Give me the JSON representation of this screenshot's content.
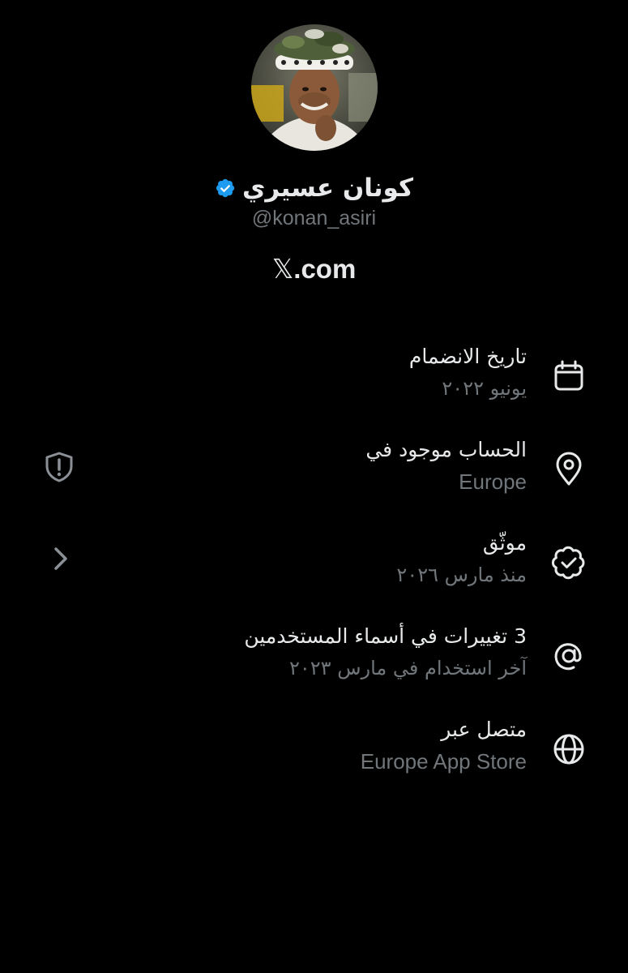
{
  "profile": {
    "display_name": "كونان عسيري",
    "handle": "@konan_asiri",
    "verified": true,
    "verified_color": "#1d9bf0",
    "avatar": "profile-photo",
    "site_mark": "𝕏",
    "site_suffix": ".com"
  },
  "rows": [
    {
      "icon": "calendar-icon",
      "title": "تاريخ الانضمام",
      "subtitle": "يونيو ٢٠٢٢"
    },
    {
      "icon": "location-pin-icon",
      "title": "الحساب موجود في",
      "subtitle": "Europe"
    },
    {
      "icon": "verified-badge-outline-icon",
      "title": "موثّق",
      "subtitle": "منذ مارس ٢٠٢٦"
    },
    {
      "icon": "at-sign-icon",
      "title": "3 تغييرات في أسماء المستخدمين",
      "subtitle": "آخر استخدام في مارس ٢٠٢٣"
    },
    {
      "icon": "globe-icon",
      "title": "متصل عبر",
      "subtitle": "Europe App Store"
    }
  ],
  "side_icons": {
    "location_row": "shield-alert-icon",
    "verified_row": "chevron-right-icon"
  },
  "colors": {
    "background": "#000000",
    "primary_text": "#e7e9ea",
    "secondary_text": "#71767b",
    "accent": "#1d9bf0"
  }
}
